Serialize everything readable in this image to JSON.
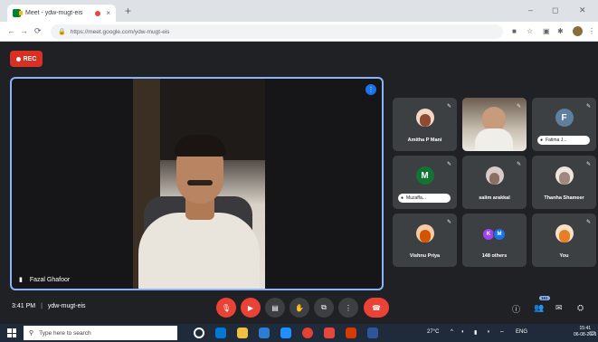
{
  "browser": {
    "tab_title": "Meet - ydw-mugt-eis",
    "tab_close": "×",
    "new_tab": "+",
    "url": "https://meet.google.com/ydw-mugt-eis",
    "window_controls": [
      "–",
      "◻",
      "✕"
    ]
  },
  "meet": {
    "rec_label": "REC",
    "main_speaker": {
      "name": "Fazal Ghafoor"
    },
    "participants": [
      {
        "name": "Amitha P Mani",
        "type": "avatar",
        "color": "#c0392b"
      },
      {
        "name": "",
        "type": "video"
      },
      {
        "name": "Fatima J...",
        "type": "letter",
        "letter": "F",
        "color": "#5f7f9f",
        "pill": true
      },
      {
        "name": "Muzaffa...",
        "type": "letter",
        "letter": "M",
        "color": "#137333",
        "pill": true
      },
      {
        "name": "salim arakkal",
        "type": "avatar",
        "color": "#8d6e63"
      },
      {
        "name": "Thanha Shameer",
        "type": "avatar",
        "color": "#a1887f"
      },
      {
        "name": "Vishnu Priya",
        "type": "avatar",
        "color": "#d35400"
      },
      {
        "name": "148 others",
        "type": "others",
        "initials": [
          "K",
          "M"
        ]
      },
      {
        "name": "You",
        "type": "avatar",
        "color": "#e67e22"
      }
    ],
    "meeting_time": "3:41 PM",
    "meeting_code": "ydw-mugt-eis",
    "people_count": "161"
  },
  "taskbar": {
    "search_placeholder": "Type here to search",
    "weather": "27°C",
    "lang": "ENG",
    "time": "15:41",
    "date": "06-08-2021"
  },
  "colors": {
    "meet_bg": "#202124",
    "tile_bg": "#3c4043",
    "accent_blue": "#8ab4f8",
    "red": "#ea4335"
  }
}
